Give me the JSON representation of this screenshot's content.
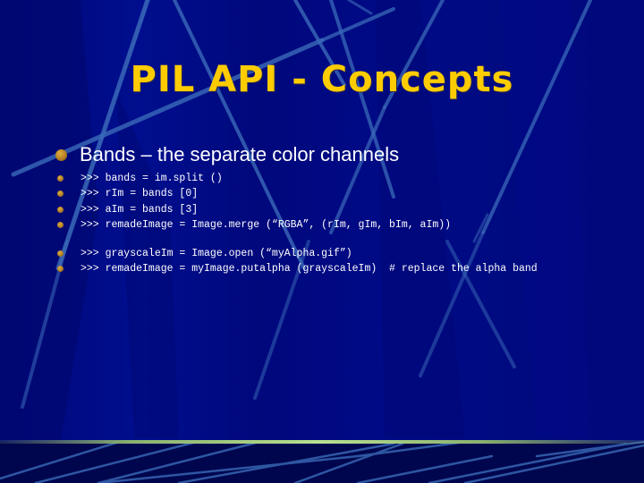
{
  "slide": {
    "title": "PIL API - Concepts",
    "main_bullet": "Bands – the separate color channels",
    "code_group_1": [
      ">>> bands = im.split ()",
      ">>> rIm = bands [0]",
      ">>> aIm = bands [3]",
      ">>> remadeImage = Image.merge (“RGBA”, (rIm, gIm, bIm, aIm))"
    ],
    "code_group_2": [
      ">>> grayscaleIm = Image.open (“myAlpha.gif”)",
      ">>> remadeImage = myImage.putalpha (grayscaleIm)  # replace the alpha band"
    ]
  },
  "colors": {
    "background": "#000a80",
    "title": "#ffcc00",
    "text": "#ffffff",
    "bullet": "#c08a28",
    "accent_line": "#b8e090",
    "streak": "#3a6ab8"
  }
}
